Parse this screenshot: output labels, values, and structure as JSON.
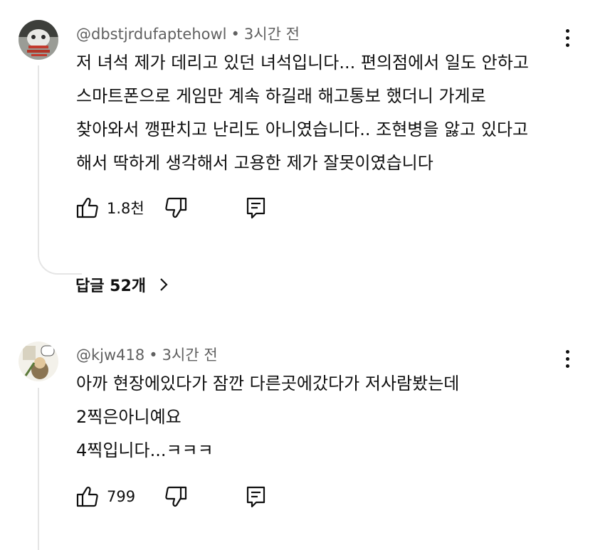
{
  "comments": [
    {
      "author": "@dbstjrdufaptehowl",
      "time": "3시간 전",
      "lines": [
        "저 녀석 제가 데리고 있던 녀석입니다... 편의점에서 일도 안하고",
        "스마트폰으로 게임만 계속 하길래 해고통보 했더니 가게로",
        "찾아와서 깽판치고 난리도 아니였습니다.. 조현병을 앓고 있다고",
        "해서 딱하게 생각해서 고용한 제가 잘못이였습니다"
      ],
      "likes": "1.8천",
      "replies_label": "답글 52개"
    },
    {
      "author": "@kjw418",
      "time": "3시간 전",
      "lines": [
        "아까 현장에있다가 잠깐 다른곳에갔다가  저사람봤는데",
        "2찍은아니예요",
        "4찍입니다...ㅋㅋㅋ"
      ],
      "likes": "799"
    }
  ],
  "separator": "•",
  "icons": {
    "like": "thumb-up-icon",
    "dislike": "thumb-down-icon",
    "reply": "reply-icon",
    "menu": "more-vert-icon",
    "replies_chevron": "chevron-right-icon"
  }
}
